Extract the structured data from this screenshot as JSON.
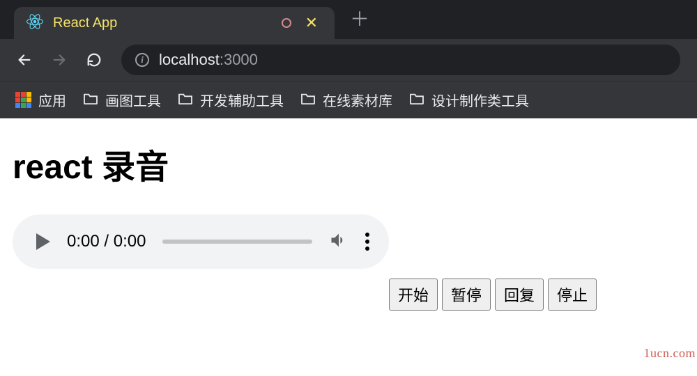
{
  "tab": {
    "title": "React App"
  },
  "address": {
    "host": "localhost",
    "port": ":3000"
  },
  "bookmarks": {
    "apps_label": "应用",
    "items": [
      {
        "label": "画图工具"
      },
      {
        "label": "开发辅助工具"
      },
      {
        "label": "在线素材库"
      },
      {
        "label": "设计制作类工具"
      }
    ]
  },
  "page": {
    "heading": "react 录音",
    "audio": {
      "current": "0:00",
      "sep": " / ",
      "total": "0:00"
    },
    "buttons": {
      "start": "开始",
      "pause": "暂停",
      "resume": "回复",
      "stop": "停止"
    }
  },
  "watermark": "1ucn.com"
}
